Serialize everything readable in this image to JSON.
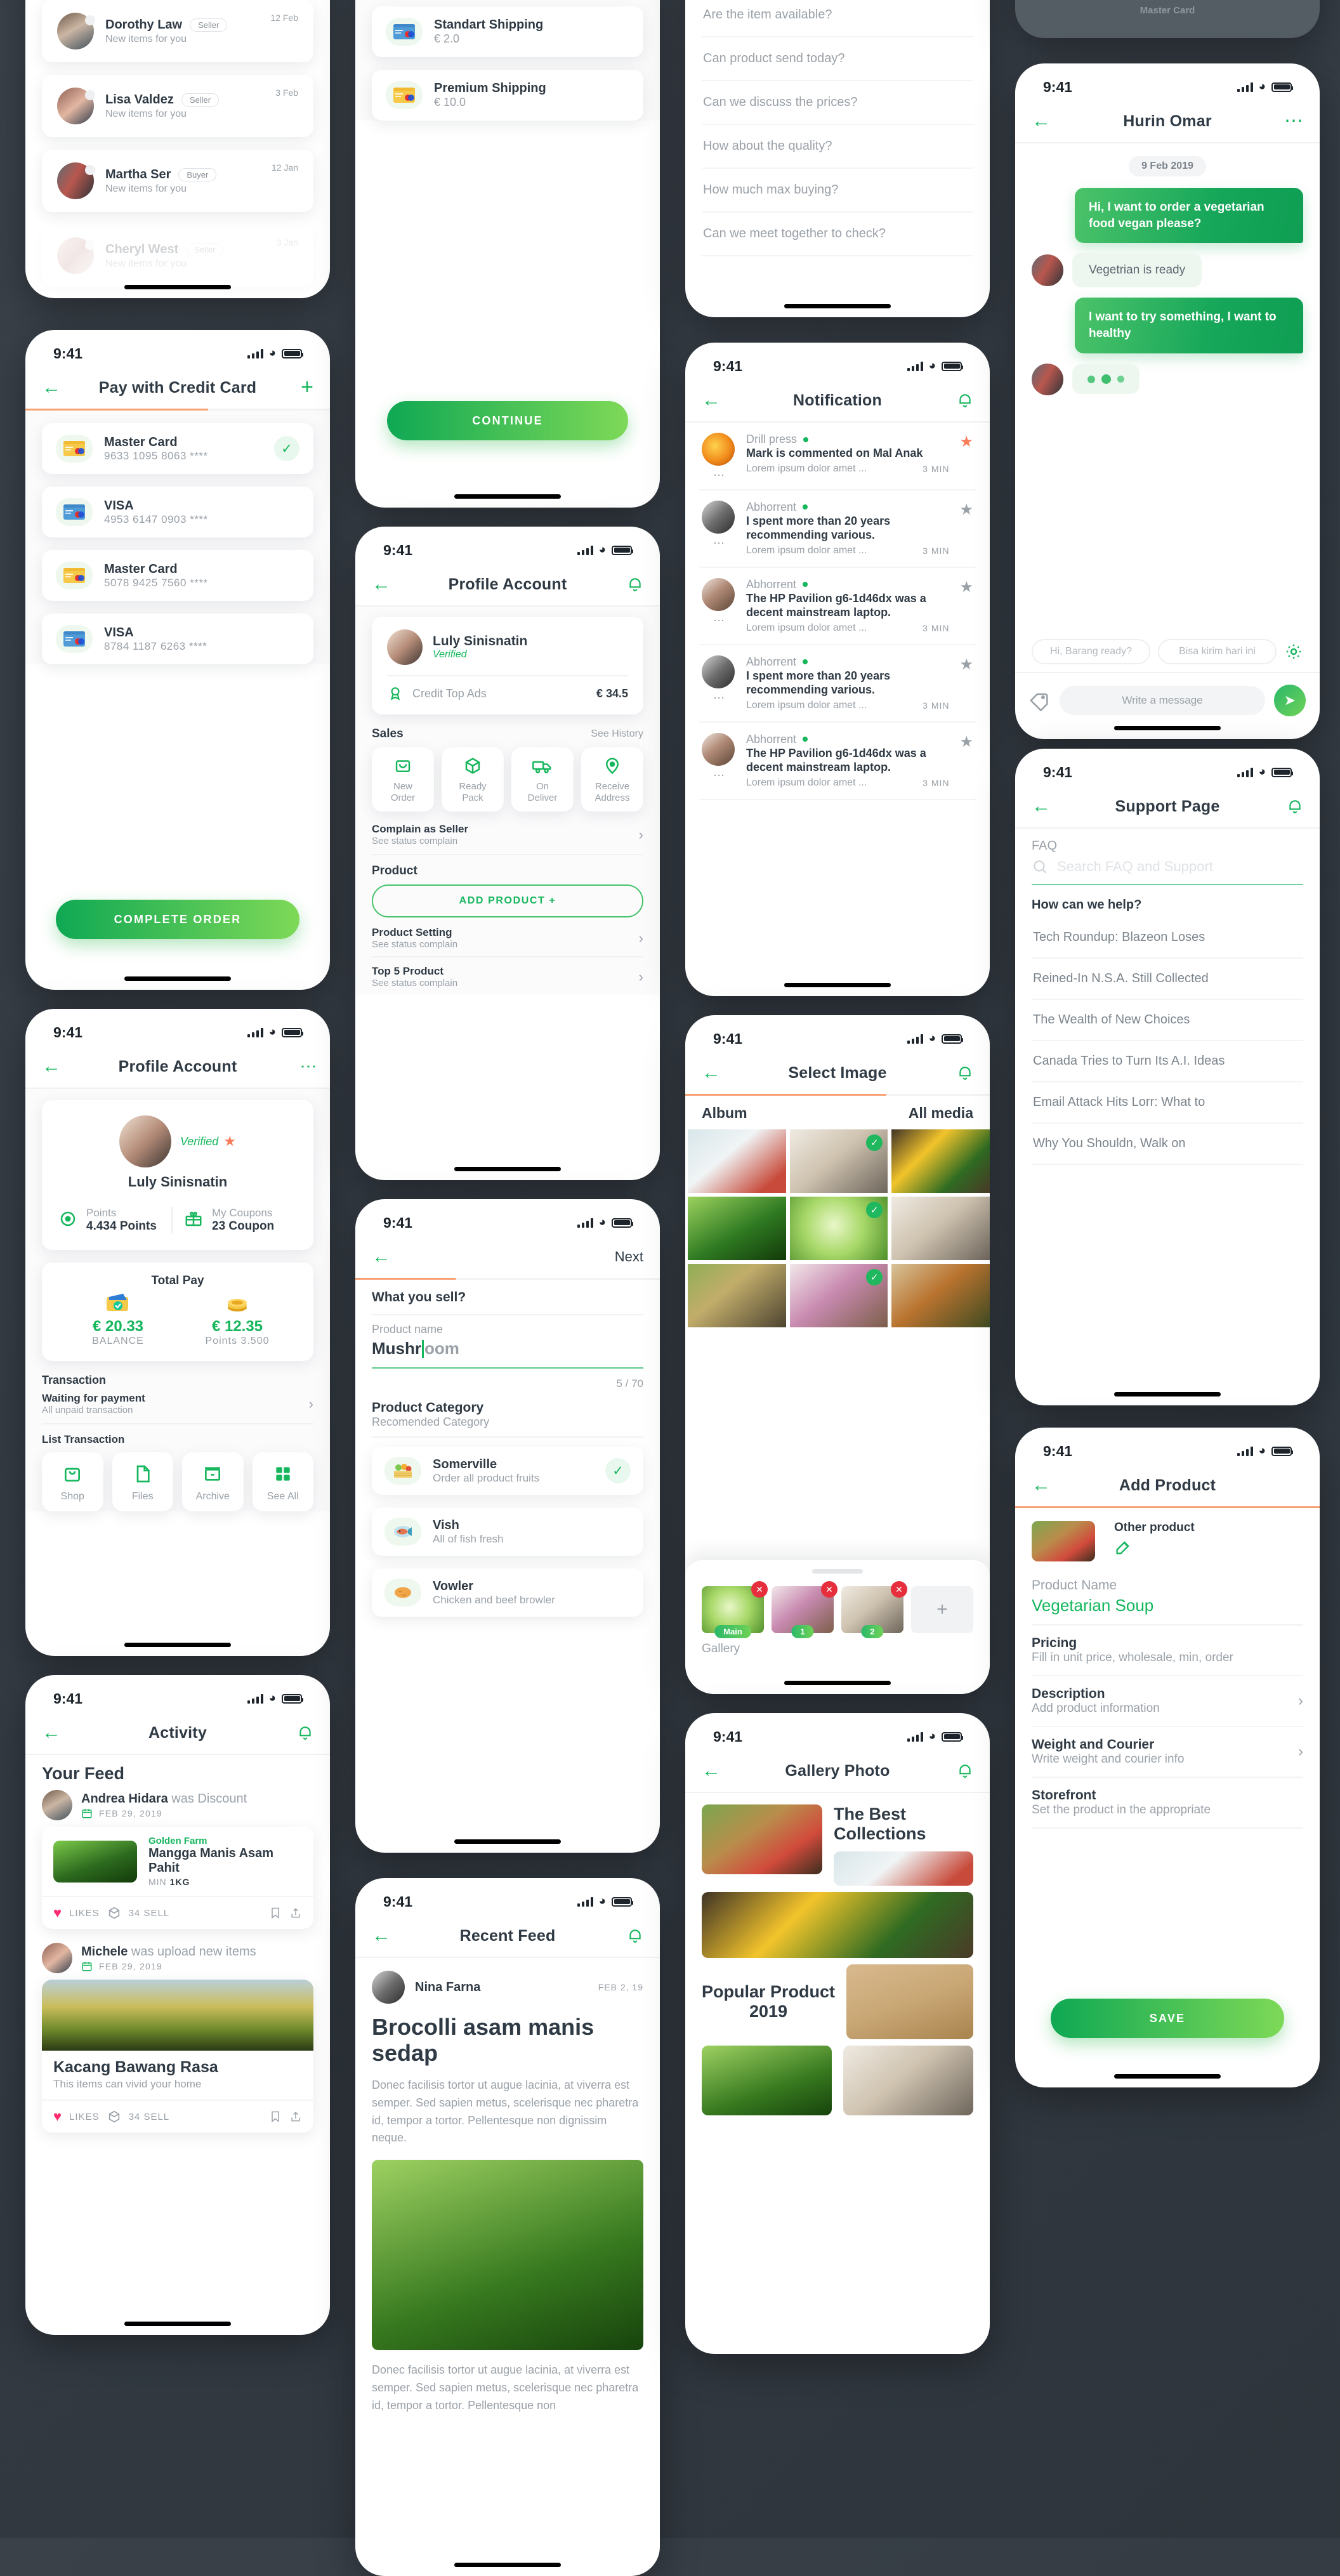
{
  "statusbar": {
    "time": "9:41"
  },
  "chat_list": {
    "items": [
      {
        "name": "Dorothy Law",
        "badge": "Seller",
        "sub": "New items for you",
        "date": "12 Feb"
      },
      {
        "name": "Lisa Valdez",
        "badge": "Seller",
        "sub": "New items for you",
        "date": "3 Feb"
      },
      {
        "name": "Martha Ser",
        "badge": "Buyer",
        "sub": "New items for you",
        "date": "12 Jan"
      },
      {
        "name": "Cheryl West",
        "badge": "Seller",
        "sub": "New items for you",
        "date": "3 Jan"
      }
    ]
  },
  "credit_card": {
    "title": "Pay with Credit Card",
    "add_label": "+",
    "cards": [
      {
        "name": "Master Card",
        "number": "9633 1095 8063 ****",
        "type": "master",
        "selected": true
      },
      {
        "name": "VISA",
        "number": "4953 6147 0903 ****",
        "type": "visa",
        "selected": false
      },
      {
        "name": "Master Card",
        "number": "5078 9425 7560 ****",
        "type": "master",
        "selected": false
      },
      {
        "name": "VISA",
        "number": "8784 1187 6263 ****",
        "type": "visa",
        "selected": false
      }
    ],
    "complete_button": "COMPLETE ORDER"
  },
  "shipping": {
    "options": [
      {
        "name": "Standart Shipping",
        "price": "€ 2.0",
        "type": "visa"
      },
      {
        "name": "Premium Shipping",
        "price": "€ 10.0",
        "type": "master"
      }
    ],
    "continue_button": "CONTINUE"
  },
  "profile_buyer": {
    "title": "Profile Account",
    "name": "Luly Sinisnatin",
    "verified": "Verified",
    "stats": [
      {
        "label": "Points",
        "value": "4.434 Points",
        "icon": "target-icon"
      },
      {
        "label": "My Coupons",
        "value": "23 Coupon",
        "icon": "gift-icon"
      }
    ],
    "total_pay_title": "Total Pay",
    "pay": [
      {
        "amount": "€ 20.33",
        "label": "BALANCE",
        "icon": "wallet-icon"
      },
      {
        "amount": "€ 12.35",
        "label": "Points 3.500",
        "icon": "coins-icon"
      }
    ],
    "transaction_title": "Transaction",
    "transaction_row": {
      "title": "Waiting for payment",
      "sub": "All unpaid transaction"
    },
    "list_title": "List Transaction",
    "list_items": [
      {
        "label": "Shop",
        "icon": "shop-bag-icon"
      },
      {
        "label": "Files",
        "icon": "file-icon"
      },
      {
        "label": "Archive",
        "icon": "archive-icon"
      },
      {
        "label": "See All",
        "icon": "grid-icon"
      }
    ]
  },
  "profile_seller": {
    "title": "Profile Account",
    "name": "Luly Sinisnatin",
    "verified": "Verified",
    "credit_label": "Credit Top Ads",
    "credit_value": "€ 34.5",
    "sales_title": "Sales",
    "see_history": "See History",
    "sales_items": [
      {
        "label": "New\nOrder",
        "icon": "inbox-icon"
      },
      {
        "label": "Ready\nPack",
        "icon": "box-icon"
      },
      {
        "label": "On\nDeliver",
        "icon": "truck-icon"
      },
      {
        "label": "Receive\nAddress",
        "icon": "pin-icon"
      }
    ],
    "rows": [
      {
        "title": "Complain as Seller",
        "sub": "See status complain"
      },
      {
        "title": "Product Setting",
        "sub": "See status complain"
      },
      {
        "title": "Top 5 Product",
        "sub": "See status complain"
      }
    ],
    "product_title": "Product",
    "add_product_button": "ADD PRODUCT +"
  },
  "sell_form": {
    "next_label": "Next",
    "heading": "What you sell?",
    "field_label": "Product name",
    "typed_value": "Mushr",
    "placeholder_rest": "oom",
    "counter": "5 / 70",
    "category_title": "Product Category",
    "category_sub": "Recomended Category",
    "categories": [
      {
        "name": "Somerville",
        "sub": "Order all product fruits",
        "icon": "fruit-crate-icon",
        "selected": true
      },
      {
        "name": "Vish",
        "sub": "All of fish fresh",
        "icon": "fish-icon",
        "selected": false
      },
      {
        "name": "Vowler",
        "sub": "Chicken and beef browler",
        "icon": "bread-icon",
        "selected": false
      }
    ]
  },
  "recent_feed": {
    "title": "Recent Feed",
    "author": "Nina Farna",
    "date": "FEB 2, 19",
    "headline": "Brocolli asam manis sedap",
    "paragraph1": "Donec facilisis tortor ut augue lacinia, at viverra est semper. Sed sapien metus, scelerisque nec pharetra id, tempor a tortor. Pellentesque non dignissim neque.",
    "paragraph2": "Donec facilisis tortor ut augue lacinia, at viverra est semper. Sed sapien metus, scelerisque nec pharetra id, tempor a tortor. Pellentesque non"
  },
  "quick_questions": {
    "items": [
      "Are the item available?",
      "Can product send today?",
      "Can we discuss the prices?",
      "How about the quality?",
      "How much max buying?",
      "Can we meet together to check?"
    ]
  },
  "notification": {
    "title": "Notification",
    "items": [
      {
        "name": "Drill press",
        "text": "Mark is commented on Mal Anak",
        "sub": "Lorem ipsum dolor amet ...",
        "time": "3 MIN",
        "starred": true,
        "avatar": "ph-fire"
      },
      {
        "name": "Abhorrent",
        "text": "I spent more than 20 years recommending various.",
        "sub": "Lorem ipsum dolor amet ...",
        "time": "3 MIN",
        "starred": false,
        "avatar": "ph-bw1"
      },
      {
        "name": "Abhorrent",
        "text": "The HP Pavilion g6-1d46dx was a decent mainstream laptop.",
        "sub": "Lorem ipsum dolor amet ...",
        "time": "3 MIN",
        "starred": false,
        "avatar": "ph-bw2"
      },
      {
        "name": "Abhorrent",
        "text": "I spent more than 20 years recommending various.",
        "sub": "Lorem ipsum dolor amet ...",
        "time": "3 MIN",
        "starred": false,
        "avatar": "ph-bw1"
      },
      {
        "name": "Abhorrent",
        "text": "The HP Pavilion g6-1d46dx was a decent mainstream laptop.",
        "sub": "Lorem ipsum dolor amet ...",
        "time": "3 MIN",
        "starred": false,
        "avatar": "ph-bw2"
      }
    ]
  },
  "select_image": {
    "title": "Select Image",
    "tab_left": "Album",
    "tab_right": "All media",
    "grid": [
      {
        "fill": "ph-plates",
        "checked": false
      },
      {
        "fill": "ph-radish",
        "checked": true
      },
      {
        "fill": "ph-corn",
        "checked": false
      },
      {
        "fill": "ph-greens",
        "checked": false
      },
      {
        "fill": "ph-cucumber",
        "checked": true
      },
      {
        "fill": "ph-radish",
        "checked": false
      },
      {
        "fill": "ph-mkt",
        "checked": false
      },
      {
        "fill": "ph-onion",
        "checked": true
      },
      {
        "fill": "ph-farmer",
        "checked": false
      }
    ],
    "gallery_label": "Gallery",
    "selected": [
      {
        "fill": "ph-cucumber",
        "tag": "Main"
      },
      {
        "fill": "ph-onion",
        "tag": "1"
      },
      {
        "fill": "ph-radish",
        "tag": "2"
      }
    ],
    "add_tile": "+"
  },
  "gallery_photo": {
    "title": "Gallery Photo",
    "heading1": "The Best Collections",
    "heading2": "Popular Product 2019",
    "tiles": [
      "ph-veg-basket",
      "ph-plates",
      "ph-corn",
      "ph-board",
      "ph-bok",
      "ph-radish"
    ]
  },
  "chat": {
    "title": "Hurin Omar",
    "date_chip": "9 Feb 2019",
    "messages": [
      {
        "from": "me",
        "text": "Hi, I want to order a vegetarian food vegan please?"
      },
      {
        "from": "them",
        "text": "Vegetrian is ready"
      },
      {
        "from": "me",
        "text": "I want to try something, I want to healthy"
      },
      {
        "from": "them",
        "text": "typing"
      }
    ],
    "suggestions": [
      "Hi, Barang ready?",
      "Bisa kirim hari ini"
    ],
    "input_placeholder": "Write a message"
  },
  "support": {
    "title": "Support Page",
    "faq_label": "FAQ",
    "search_placeholder": "Search FAQ and Support",
    "heading": "How can we help?",
    "items": [
      "Tech Roundup: Blazeon Loses",
      "Reined-In N.S.A. Still Collected",
      "The Wealth of New Choices",
      "Canada Tries to Turn Its A.I. Ideas",
      "Email Attack Hits Lorr: What to",
      "Why You Shouldn, Walk on"
    ]
  },
  "add_product": {
    "title": "Add Product",
    "other_product": "Other product",
    "name_label": "Product Name",
    "name_value": "Vegetarian Soup",
    "rows": [
      {
        "title": "Pricing",
        "sub": "Fill in unit price, wholesale, min, order",
        "chevron": false
      },
      {
        "title": "Description",
        "sub": "Add product information",
        "chevron": true
      },
      {
        "title": "Weight and Courier",
        "sub": "Write weight and courier info",
        "chevron": true
      },
      {
        "title": "Storefront",
        "sub": "Set the product in the appropriate",
        "chevron": false
      }
    ],
    "save_button": "SAVE"
  },
  "activity": {
    "title": "Activity",
    "feed_title": "Your Feed",
    "posts": [
      {
        "author": "Andrea Hidara",
        "action": "was Discount",
        "date": "FEB 29, 2019",
        "brand": "Golden Farm",
        "product": "Mangga Manis Asam Pahit",
        "meta_min": "MIN",
        "meta_qty": "1KG",
        "likes": "LIKES",
        "sells": "34 SELL",
        "avatar": "ph-lady1",
        "image": "ph-leaf",
        "layout": "side"
      },
      {
        "author": "Michele",
        "action": "was upload new items",
        "date": "FEB 29, 2019",
        "product": "Kacang Bawang Rasa",
        "caption": "This items can vivid your home",
        "likes": "LIKES",
        "sells": "34 SELL",
        "avatar": "ph-lady2",
        "image": "ph-field",
        "layout": "stacked"
      }
    ]
  },
  "colors": {
    "accent": "#15b65c",
    "accent2": "#7ed957",
    "orange": "#f7a072",
    "star": "#f97d5a",
    "heart": "#ff2d6f"
  }
}
